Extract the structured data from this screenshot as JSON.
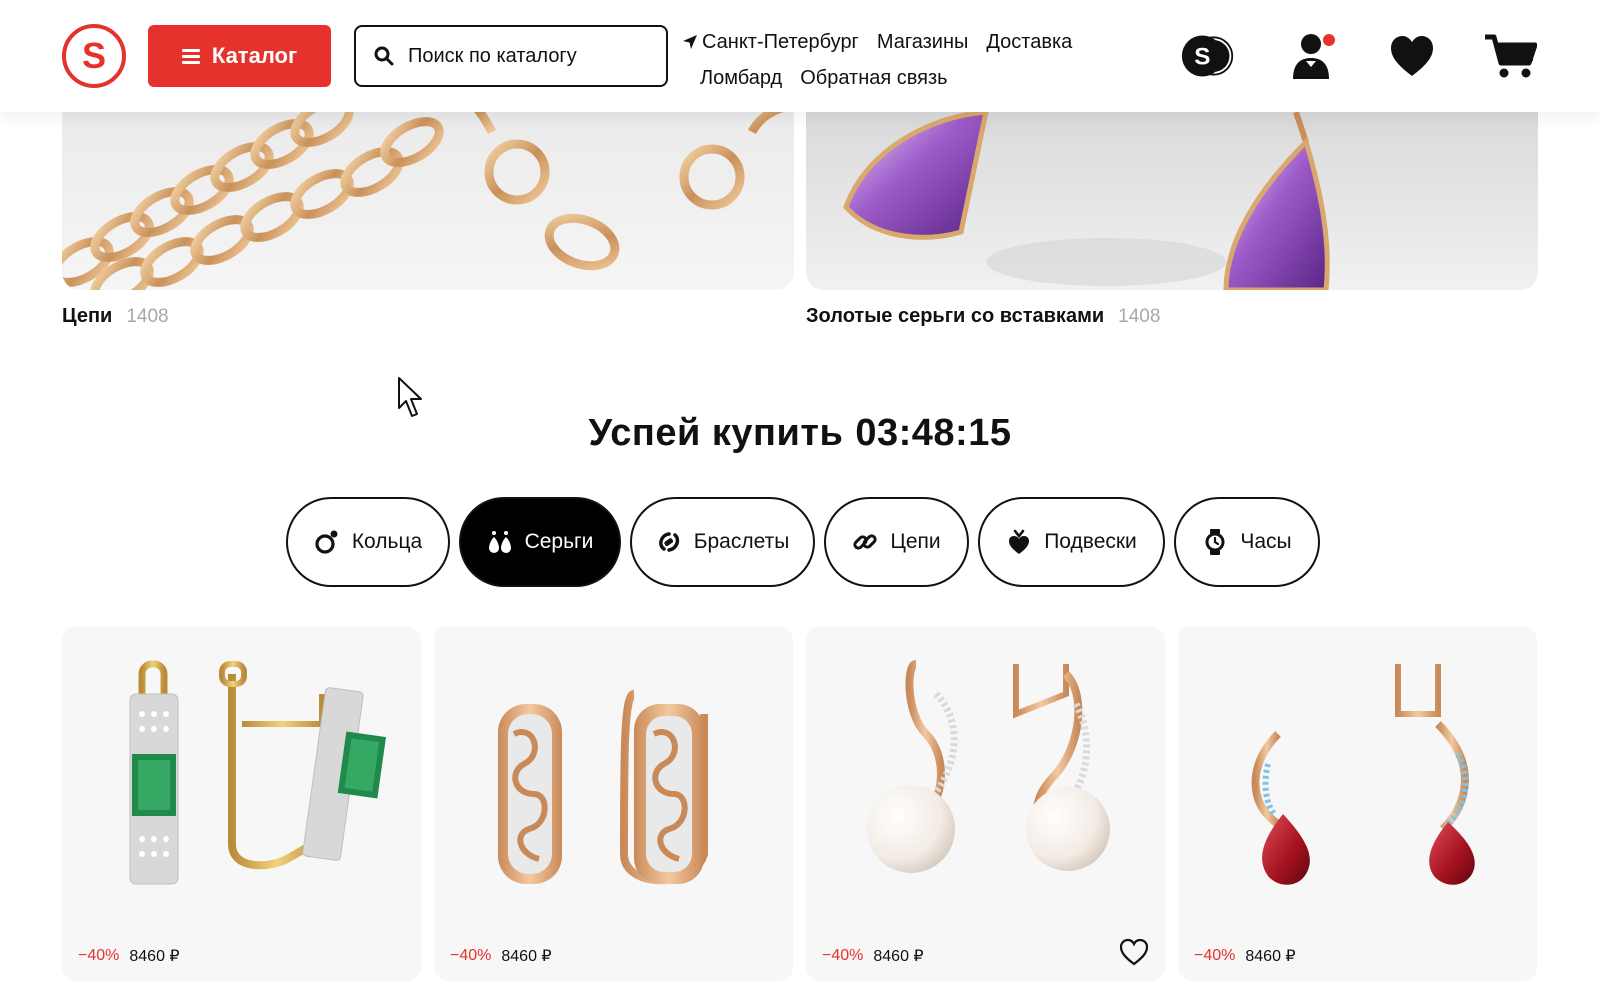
{
  "header": {
    "logo_letter": "S",
    "catalog_label": "Каталог",
    "search_placeholder": "Поиск по каталогу",
    "nav": {
      "city": "Санкт-Петербург",
      "stores": "Магазины",
      "delivery": "Доставка",
      "pawnshop": "Ломбард",
      "feedback": "Обратная связь"
    },
    "icons": [
      "coins-icon",
      "user-icon",
      "heart-icon",
      "cart-icon"
    ],
    "brand_color": "#e5322d"
  },
  "banners": [
    {
      "title": "Цепи",
      "count": "1408"
    },
    {
      "title": "Золотые серьги со вставками",
      "count": "1408"
    }
  ],
  "promo": {
    "title": "Успей купить",
    "timer": "03:48:15"
  },
  "tabs": [
    {
      "label": "Кольца",
      "icon": "ring-icon",
      "active": false
    },
    {
      "label": "Серьги",
      "icon": "earrings-icon",
      "active": true
    },
    {
      "label": "Браслеты",
      "icon": "bracelet-icon",
      "active": false
    },
    {
      "label": "Цепи",
      "icon": "chain-icon",
      "active": false
    },
    {
      "label": "Подвески",
      "icon": "pendant-icon",
      "active": false
    },
    {
      "label": "Часы",
      "icon": "watch-icon",
      "active": false
    }
  ],
  "products": [
    {
      "discount": "−40%",
      "price": "8460 ₽",
      "stone": "emerald",
      "stone_color": "#1f8a4c"
    },
    {
      "discount": "−40%",
      "price": "8460 ₽",
      "stone": "diamond-filigree",
      "stone_color": "#d9d9d9"
    },
    {
      "discount": "−40%",
      "price": "8460 ₽",
      "stone": "pearl",
      "stone_color": "#f6efe9"
    },
    {
      "discount": "−40%",
      "price": "8460 ₽",
      "stone": "garnet",
      "stone_color": "#a3111e"
    }
  ]
}
